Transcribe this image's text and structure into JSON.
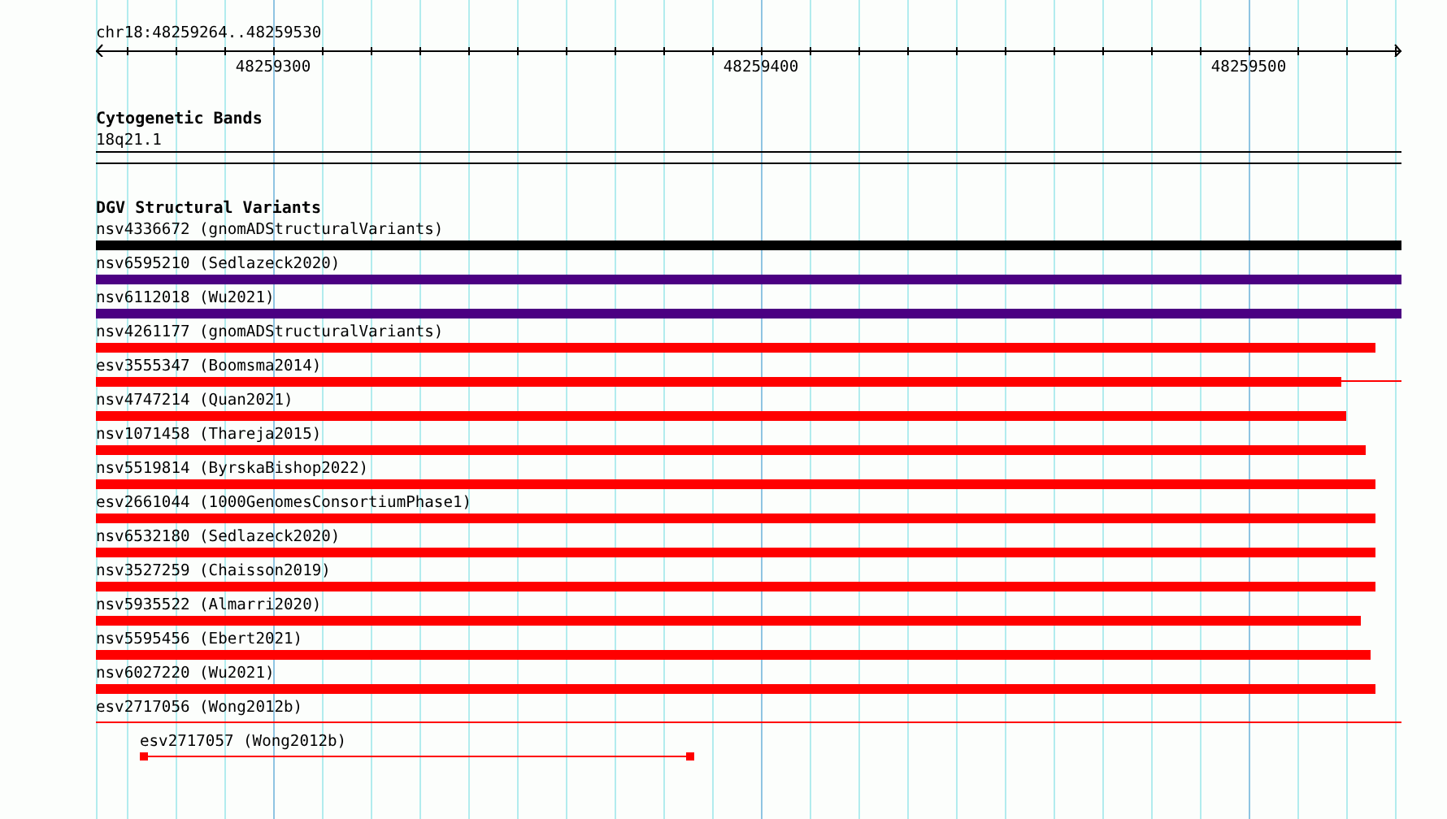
{
  "ruler": {
    "title": "chr18:48259264..48259530",
    "labels": [
      "48259300",
      "48259400",
      "48259500"
    ]
  },
  "tracks": [
    {
      "title": "Cytogenetic Bands",
      "features": [
        {
          "label": "18q21.1",
          "kind": "band"
        }
      ]
    },
    {
      "title": "DGV Structural Variants",
      "features": [
        {
          "label": "nsv4336672 (gnomADStructuralVariants)",
          "kind": "bar",
          "color": "#000000",
          "level": 1
        },
        {
          "label": "nsv6595210 (Sedlazeck2020)",
          "kind": "bar",
          "color": "#4b0082",
          "level": 1
        },
        {
          "label": "nsv6112018 (Wu2021)",
          "kind": "bar",
          "color": "#4b0082",
          "level": 1
        },
        {
          "label": "nsv4261177 (gnomADStructuralVariants)",
          "kind": "bar",
          "color": "#ff0000",
          "level": 0.98
        },
        {
          "label": "esv3555347 (Boomsma2014)",
          "kind": "bar_line",
          "color": "#ff0000",
          "level": 0.954
        },
        {
          "label": "nsv4747214 (Quan2021)",
          "kind": "bar",
          "color": "#ff0000",
          "level": 0.958
        },
        {
          "label": "nsv1071458 (Thareja2015)",
          "kind": "bar",
          "color": "#ff0000",
          "level": 0.973
        },
        {
          "label": "nsv5519814 (ByrskaBishop2022)",
          "kind": "bar",
          "color": "#ff0000",
          "level": 0.98
        },
        {
          "label": "esv2661044 (1000GenomesConsortiumPhase1)",
          "kind": "bar",
          "color": "#ff0000",
          "level": 0.98
        },
        {
          "label": "nsv6532180 (Sedlazeck2020)",
          "kind": "bar",
          "color": "#ff0000",
          "level": 0.98
        },
        {
          "label": "nsv3527259 (Chaisson2019)",
          "kind": "bar",
          "color": "#ff0000",
          "level": 0.98
        },
        {
          "label": "nsv5935522 (Almarri2020)",
          "kind": "bar",
          "color": "#ff0000",
          "level": 0.969
        },
        {
          "label": "nsv5595456 (Ebert2021)",
          "kind": "bar",
          "color": "#ff0000",
          "level": 0.976
        },
        {
          "label": "nsv6027220 (Wu2021)",
          "kind": "bar",
          "color": "#ff0000",
          "level": 0.98
        },
        {
          "label": "esv2717056 (Wong2012b)",
          "kind": "line",
          "color": "#ff0000",
          "level": 1
        },
        {
          "label": "esv2717057 (Wong2012b)",
          "kind": "interval",
          "color": "#ff0000",
          "level": 0.44
        }
      ]
    }
  ]
}
